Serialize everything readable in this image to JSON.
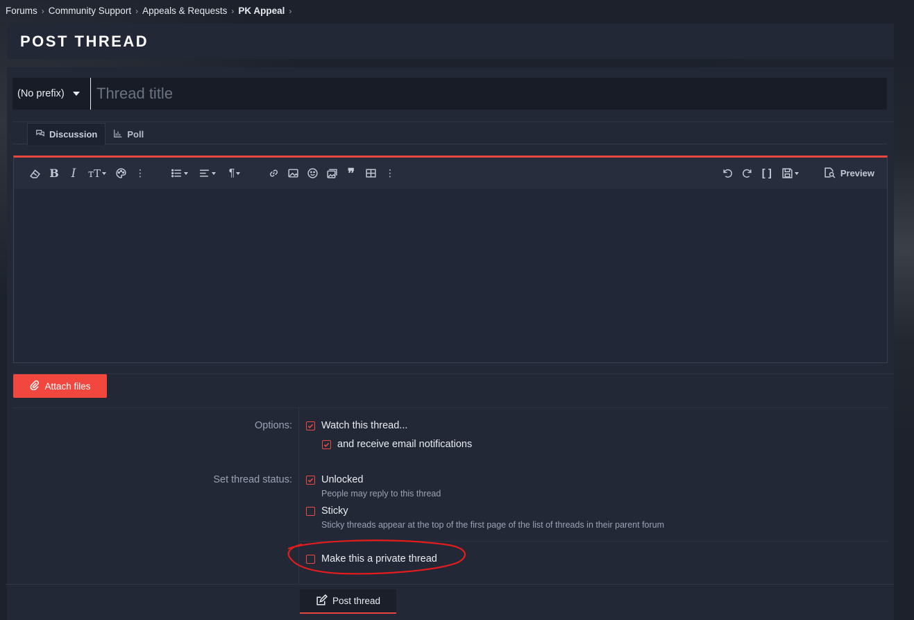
{
  "breadcrumb": {
    "items": [
      "Forums",
      "Community Support",
      "Appeals & Requests",
      "PK Appeal"
    ]
  },
  "page": {
    "title": "POST THREAD"
  },
  "title_row": {
    "prefix_label": "(No prefix)",
    "title_placeholder": "Thread title"
  },
  "tabs": [
    {
      "label": "Discussion",
      "icon": "comments-icon",
      "active": true
    },
    {
      "label": "Poll",
      "icon": "bar-chart-icon",
      "active": false
    }
  ],
  "editor": {
    "toolbar_left": [
      "eraser-icon",
      "bold-icon",
      "italic-icon",
      "text-size-icon",
      "palette-icon",
      "more-icon",
      "list-icon",
      "align-icon",
      "paragraph-icon",
      "link-icon",
      "image-icon",
      "smiley-icon",
      "media-icon",
      "quote-icon",
      "table-icon",
      "more-icon"
    ],
    "toolbar_right": [
      "undo-icon",
      "redo-icon",
      "brackets-icon",
      "save-draft-icon"
    ],
    "preview_label": "Preview"
  },
  "attach": {
    "label": "Attach files"
  },
  "options": {
    "label": "Options:",
    "watch_label": "Watch this thread...",
    "watch_checked": true,
    "email_label": "and receive email notifications",
    "email_checked": true
  },
  "status": {
    "label": "Set thread status:",
    "unlocked_label": "Unlocked",
    "unlocked_checked": true,
    "unlocked_hint": "People may reply to this thread",
    "sticky_label": "Sticky",
    "sticky_checked": false,
    "sticky_hint": "Sticky threads appear at the top of the first page of the list of threads in their parent forum"
  },
  "private": {
    "label": "Make this a private thread",
    "checked": false
  },
  "submit": {
    "label": "Post thread"
  },
  "colors": {
    "accent": "#f2473f",
    "panel": "#232836",
    "background": "#1c212c",
    "annotation": "#e51c1c"
  }
}
